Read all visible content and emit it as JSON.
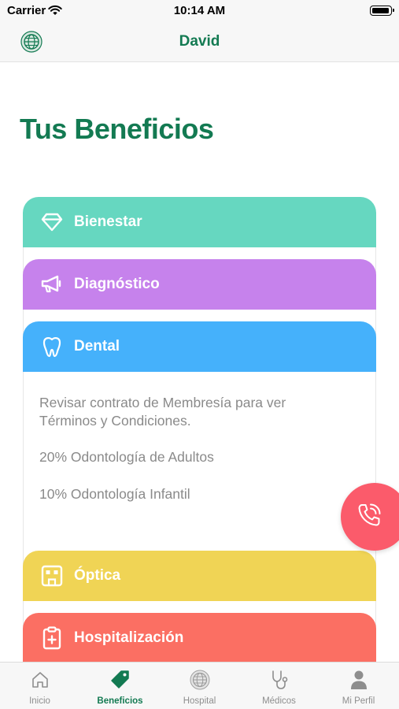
{
  "status_bar": {
    "carrier": "Carrier",
    "time": "10:14 AM"
  },
  "nav": {
    "title": "David"
  },
  "page": {
    "title": "Tus Beneficios"
  },
  "benefits": [
    {
      "label": "Bienestar",
      "icon": "diamond-icon",
      "color": "#66d7c0"
    },
    {
      "label": "Diagnóstico",
      "icon": "megaphone-icon",
      "color": "#c682ec"
    },
    {
      "label": "Dental",
      "icon": "tooth-icon",
      "color": "#45b1fb",
      "details": [
        "Revisar contrato de Membresía para ver",
        "Términos y Condiciones.",
        "20% Odontología de Adultos",
        "10% Odontología Infantil"
      ]
    },
    {
      "label": "Óptica",
      "icon": "glasses-icon",
      "color": "#f0d455"
    },
    {
      "label": "Hospitalización",
      "icon": "clipboard-medical-icon",
      "color": "#fb6f63"
    }
  ],
  "fab": {
    "icon": "phone-call-icon",
    "color": "#fb5b6b"
  },
  "tabs": [
    {
      "label": "Inicio",
      "icon": "home-icon"
    },
    {
      "label": "Beneficios",
      "icon": "tag-icon",
      "active": true
    },
    {
      "label": "Hospital",
      "icon": "globe-logo-icon"
    },
    {
      "label": "Médicos",
      "icon": "stethoscope-icon"
    },
    {
      "label": "Mi Perfil",
      "icon": "person-icon"
    }
  ],
  "colors": {
    "brand_green": "#137a52",
    "tab_inactive": "#8e8e8e",
    "detail_text": "#8a8a8a"
  }
}
